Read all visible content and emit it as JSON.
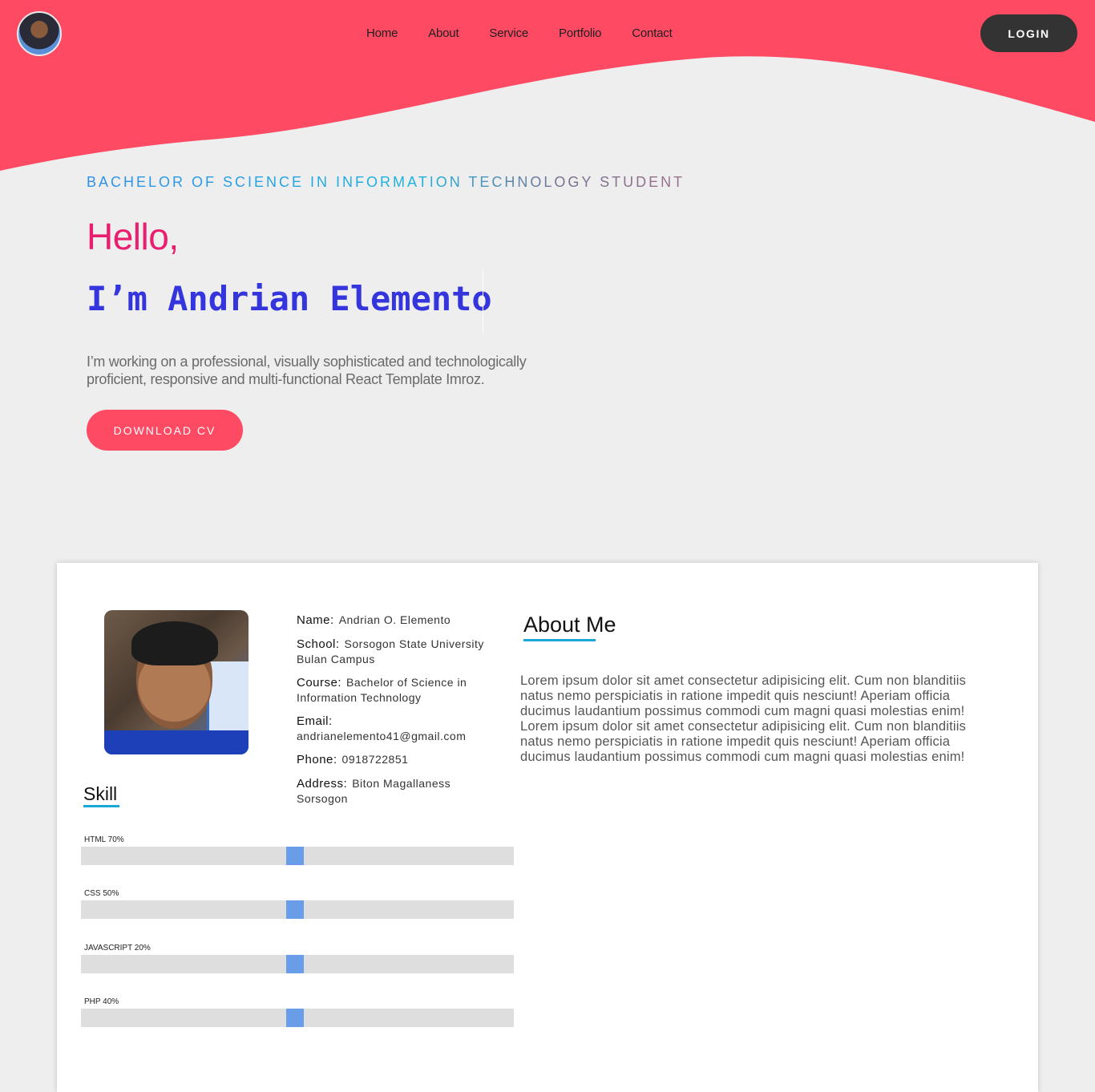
{
  "header": {
    "nav": [
      "Home",
      "About",
      "Service",
      "Portfolio",
      "Contact"
    ],
    "login_label": "LOGIN",
    "accent": "#ff4a64"
  },
  "hero": {
    "subtitle": "BACHELOR OF SCIENCE IN INFORMATION TECHNOLOGY STUDENT",
    "hello": "Hello,",
    "name": "I’m Andrian Elemento",
    "intro": "I’m working on a professional, visually sophisticated and technologically proficient, responsive and multi-functional React Template Imroz.",
    "download_label": "DOWNLOAD CV"
  },
  "profile": {
    "name_label": "Name:",
    "name_value": "Andrian O. Elemento",
    "school_label": "School:",
    "school_value": "Sorsogon State University  Bulan Campus",
    "course_label": "Course:",
    "course_value": "Bachelor of Science in Information Technology",
    "email_label": "Email:",
    "email_value": "andrianelemento41@gmail.com",
    "phone_label": "Phone:",
    "phone_value": "0918722851",
    "address_label": "Address:",
    "address_value": "Biton Magallaness Sorsogon"
  },
  "about": {
    "title": "About Me",
    "text": "Lorem ipsum dolor sit amet consectetur adipisicing elit. Cum non blanditiis natus nemo perspiciatis in ratione impedit quis nesciunt! Aperiam officia ducimus laudantium possimus commodi cum magni quasi molestias enim! Lorem ipsum dolor sit amet consectetur adipisicing elit. Cum non blanditiis natus nemo perspiciatis in ratione impedit quis nesciunt! Aperiam officia ducimus laudantium possimus commodi cum magni quasi molestias enim!"
  },
  "skills": {
    "title": "Skill",
    "items": [
      {
        "label": "HTML 70%"
      },
      {
        "label": "CSS 50%"
      },
      {
        "label": "JAVASCRIPT 20%"
      },
      {
        "label": "PHP 40%"
      }
    ]
  }
}
